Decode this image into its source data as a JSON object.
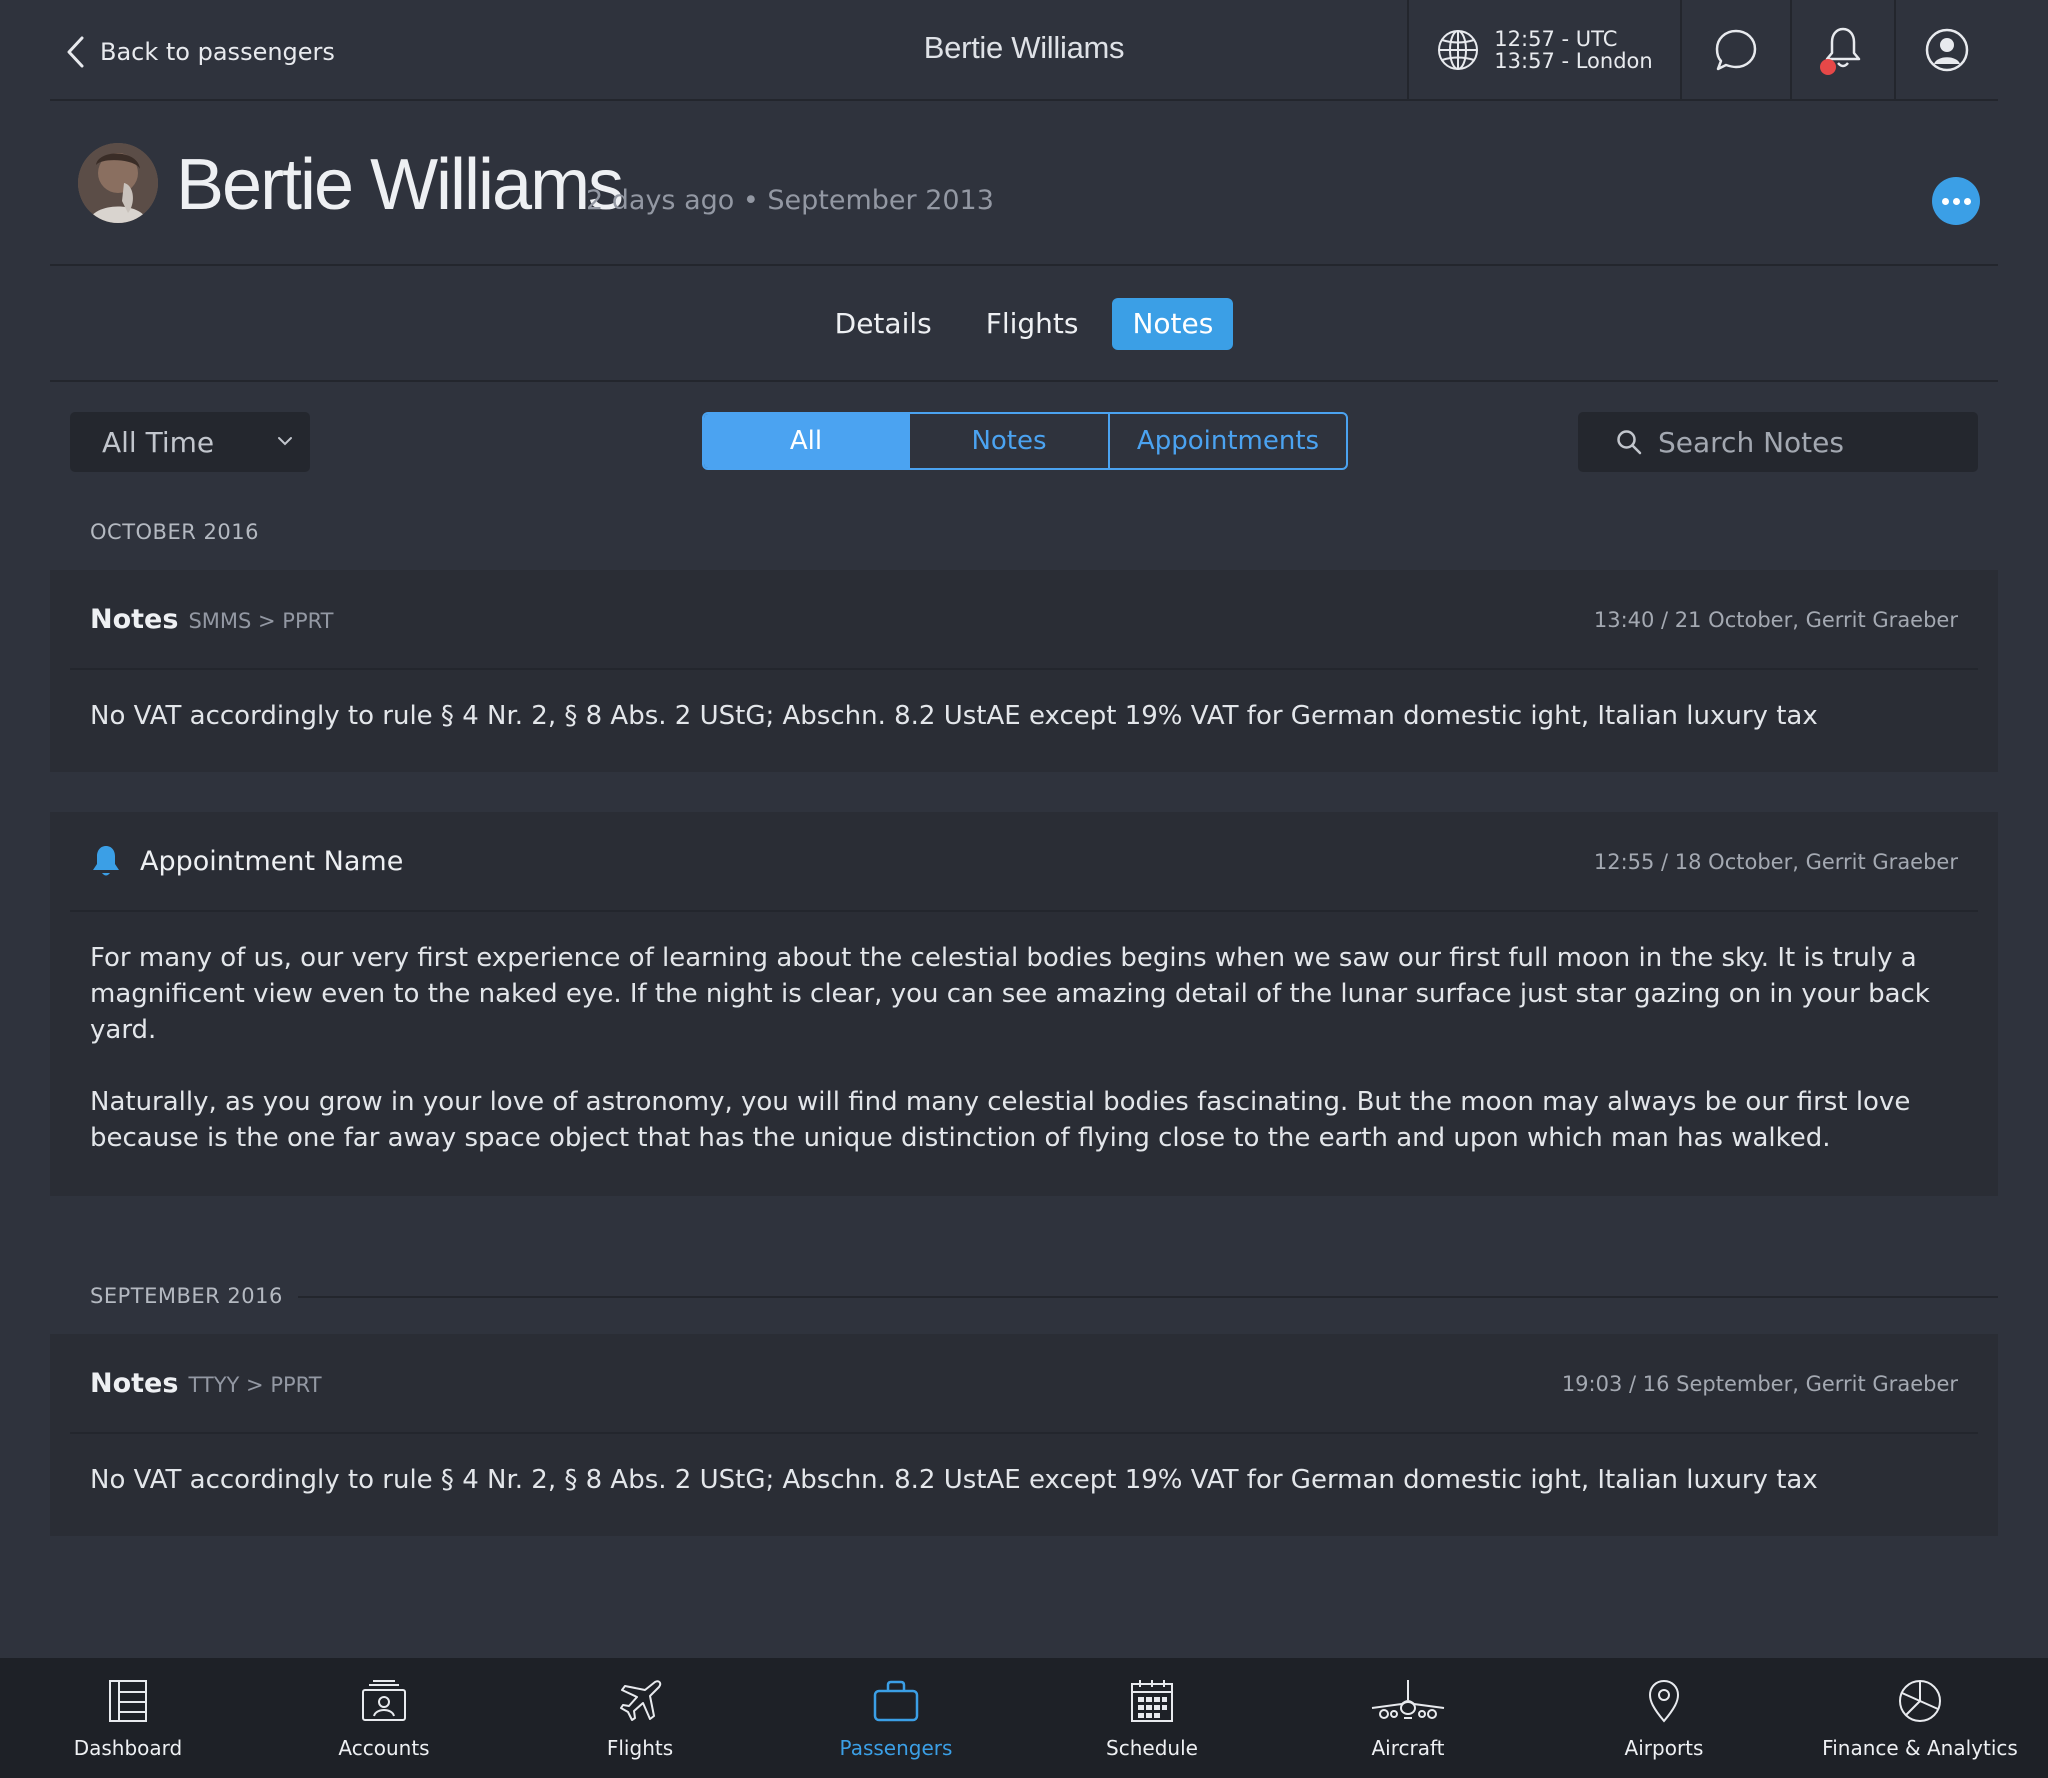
{
  "header": {
    "back_label": "Back to passengers",
    "title": "Bertie Williams",
    "time_utc": "12:57 - UTC",
    "time_local": "13:57 - London"
  },
  "profile": {
    "name": "Bertie Williams",
    "meta": "2 days ago • September 2013"
  },
  "tabs": [
    {
      "label": "Details",
      "active": false
    },
    {
      "label": "Flights",
      "active": false
    },
    {
      "label": "Notes",
      "active": true
    }
  ],
  "filters": {
    "period": "All Time",
    "segments": [
      {
        "label": "All",
        "active": true
      },
      {
        "label": "Notes",
        "active": false
      },
      {
        "label": "Appointments",
        "active": false
      }
    ],
    "search_placeholder": "Search Notes"
  },
  "sections": [
    {
      "label": "OCTOBER 2016",
      "entries": [
        {
          "kind": "note",
          "title": "Notes",
          "route": "SMMS > PPRT",
          "when": "13:40 / 21 October, Gerrit Graeber",
          "body": [
            "No VAT accordingly to rule § 4 Nr. 2, § 8 Abs. 2 UStG; Abschn. 8.2 UstAE except 19% VAT for German domestic ight, Italian luxury tax"
          ]
        },
        {
          "kind": "appointment",
          "title": "Appointment Name",
          "when": "12:55 / 18 October, Gerrit Graeber",
          "body": [
            "For many of us, our very first experience of learning about the celestial bodies begins when we saw our first full moon in the sky. It is truly a magnificent view even to the naked eye. If the night is clear, you can see amazing detail of the lunar surface just star gazing on in your back yard.",
            "Naturally, as you grow in your love of astronomy, you will find many celestial bodies fascinating. But the moon may always be our first love because is the one far away space object that has the unique distinction of flying close to the earth and upon which man has walked."
          ]
        }
      ]
    },
    {
      "label": "SEPTEMBER 2016",
      "entries": [
        {
          "kind": "note",
          "title": "Notes",
          "route": "TTYY > PPRT",
          "when": "19:03 / 16 September, Gerrit Graeber",
          "body": [
            "No VAT accordingly to rule § 4 Nr. 2, § 8 Abs. 2 UStG; Abschn. 8.2 UstAE except 19% VAT for German domestic ight, Italian luxury tax"
          ]
        }
      ]
    }
  ],
  "bottom_nav": [
    {
      "label": "Dashboard",
      "icon": "dashboard-icon",
      "active": false
    },
    {
      "label": "Accounts",
      "icon": "accounts-icon",
      "active": false
    },
    {
      "label": "Flights",
      "icon": "airplane-icon",
      "active": false
    },
    {
      "label": "Passengers",
      "icon": "briefcase-icon",
      "active": true
    },
    {
      "label": "Schedule",
      "icon": "calendar-icon",
      "active": false
    },
    {
      "label": "Aircraft",
      "icon": "aircraft-icon",
      "active": false
    },
    {
      "label": "Airports",
      "icon": "location-pin-icon",
      "active": false
    },
    {
      "label": "Finance & Analytics",
      "icon": "pie-chart-icon",
      "active": false
    }
  ],
  "colors": {
    "accent": "#3b9fe6",
    "background": "#2f333d",
    "card": "#2a2d35",
    "nav_background": "#1e2127",
    "notification_dot": "#e64848"
  }
}
